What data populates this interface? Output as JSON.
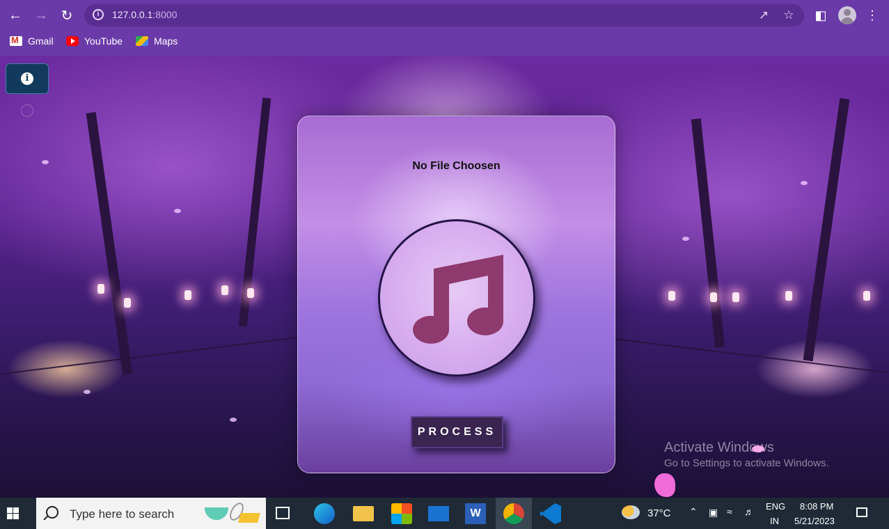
{
  "browser": {
    "url_host": "127.0.0.1",
    "url_port": ":8000",
    "bookmarks": [
      {
        "label": "Gmail",
        "icon": "gmail-icon"
      },
      {
        "label": "YouTube",
        "icon": "youtube-icon"
      },
      {
        "label": "Maps",
        "icon": "maps-icon"
      }
    ]
  },
  "page": {
    "info_icon_glyph": "i",
    "file_status": "No File Choosen",
    "process_label": "PROCESS",
    "center_icon": "music-note-icon"
  },
  "watermark": {
    "line1": "Activate Windows",
    "line2": "Go to Settings to activate Windows."
  },
  "taskbar": {
    "search_placeholder": "Type here to search",
    "weather_temp": "37°C",
    "lang_top": "ENG",
    "lang_bottom": "IN",
    "time": "8:08 PM",
    "date": "5/21/2023"
  },
  "colors": {
    "chrome_bg": "#6a3aa8",
    "card_tint": "#b07ad9",
    "note_color": "#8e3a6e",
    "button_bg": "#3a2450"
  }
}
